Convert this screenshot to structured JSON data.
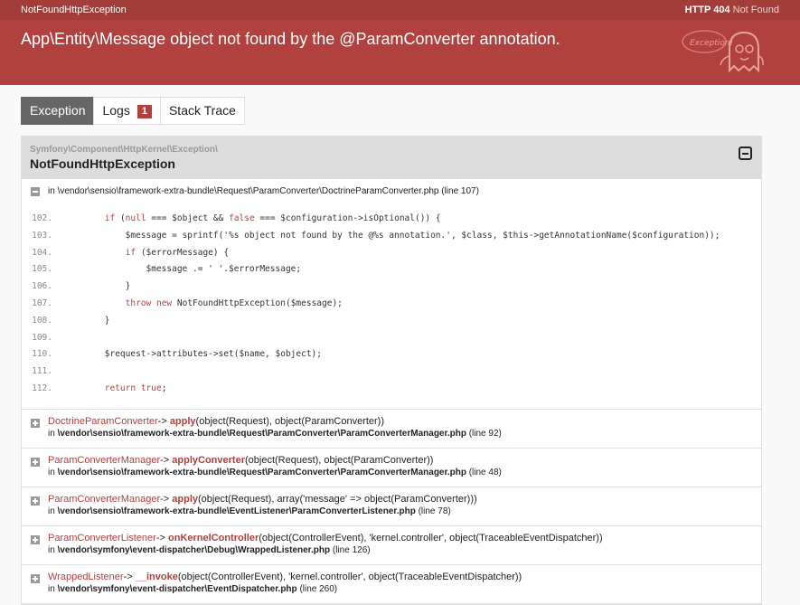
{
  "header": {
    "exception_class": "NotFoundHttpException",
    "status_code": "HTTP 404",
    "status_text": "Not Found",
    "message": "App\\Entity\\Message object not found by the @ParamConverter annotation.",
    "ghost_text": "Exception!"
  },
  "tabs": [
    {
      "label": "Exception",
      "active": true
    },
    {
      "label": "Logs",
      "badge": "1"
    },
    {
      "label": "Stack Trace"
    }
  ],
  "exception": {
    "namespace": "Symfony\\Component\\HttpKernel\\Exception\\",
    "class": "NotFoundHttpException",
    "file_prefix": "in",
    "file": "\\vendor\\sensio\\framework-extra-bundle\\Request\\ParamConverter\\DoctrineParamConverter.php",
    "line": "(line 107)"
  },
  "code_lines": [
    {
      "n": "102.",
      "code": "        if (null === $object && false === $configuration->isOptional()) {"
    },
    {
      "n": "103.",
      "code": "            $message = sprintf('%s object not found by the @%s annotation.', $class, $this->getAnnotationName($configuration));"
    },
    {
      "n": "104.",
      "code": "            if ($errorMessage) {"
    },
    {
      "n": "105.",
      "code": "                $message .= ' '.$errorMessage;"
    },
    {
      "n": "106.",
      "code": "            }"
    },
    {
      "n": "107.",
      "code": "            throw new NotFoundHttpException($message);"
    },
    {
      "n": "108.",
      "code": "        }"
    },
    {
      "n": "109.",
      "code": ""
    },
    {
      "n": "110.",
      "code": "        $request->attributes->set($name, $object);"
    },
    {
      "n": "111.",
      "code": ""
    },
    {
      "n": "112.",
      "code": "        return true;"
    }
  ],
  "trace": [
    {
      "class": "DoctrineParamConverter",
      "method": "apply",
      "args": "(object(Request), object(ParamConverter))",
      "file": "\\vendor\\sensio\\framework-extra-bundle\\Request\\ParamConverter\\ParamConverterManager.php",
      "line": "(line 92)"
    },
    {
      "class": "ParamConverterManager",
      "method": "applyConverter",
      "args": "(object(Request), object(ParamConverter))",
      "file": "\\vendor\\sensio\\framework-extra-bundle\\Request\\ParamConverter\\ParamConverterManager.php",
      "line": "(line 48)"
    },
    {
      "class": "ParamConverterManager",
      "method": "apply",
      "args": "(object(Request), array('message' => object(ParamConverter)))",
      "file": "\\vendor\\sensio\\framework-extra-bundle\\EventListener\\ParamConverterListener.php",
      "line": "(line 78)"
    },
    {
      "class": "ParamConverterListener",
      "method": "onKernelController",
      "args": "(object(ControllerEvent), 'kernel.controller', object(TraceableEventDispatcher))",
      "file": "\\vendor\\symfony\\event-dispatcher\\Debug\\WrappedListener.php",
      "line": "(line 126)"
    },
    {
      "class": "WrappedListener",
      "method": "__invoke",
      "args": "(object(ControllerEvent), 'kernel.controller', object(TraceableEventDispatcher))",
      "file": "\\vendor\\symfony\\event-dispatcher\\EventDispatcher.php",
      "line": "(line 260)"
    }
  ],
  "colors": {
    "brand": "#b0413e",
    "tab_active": "#666666"
  }
}
